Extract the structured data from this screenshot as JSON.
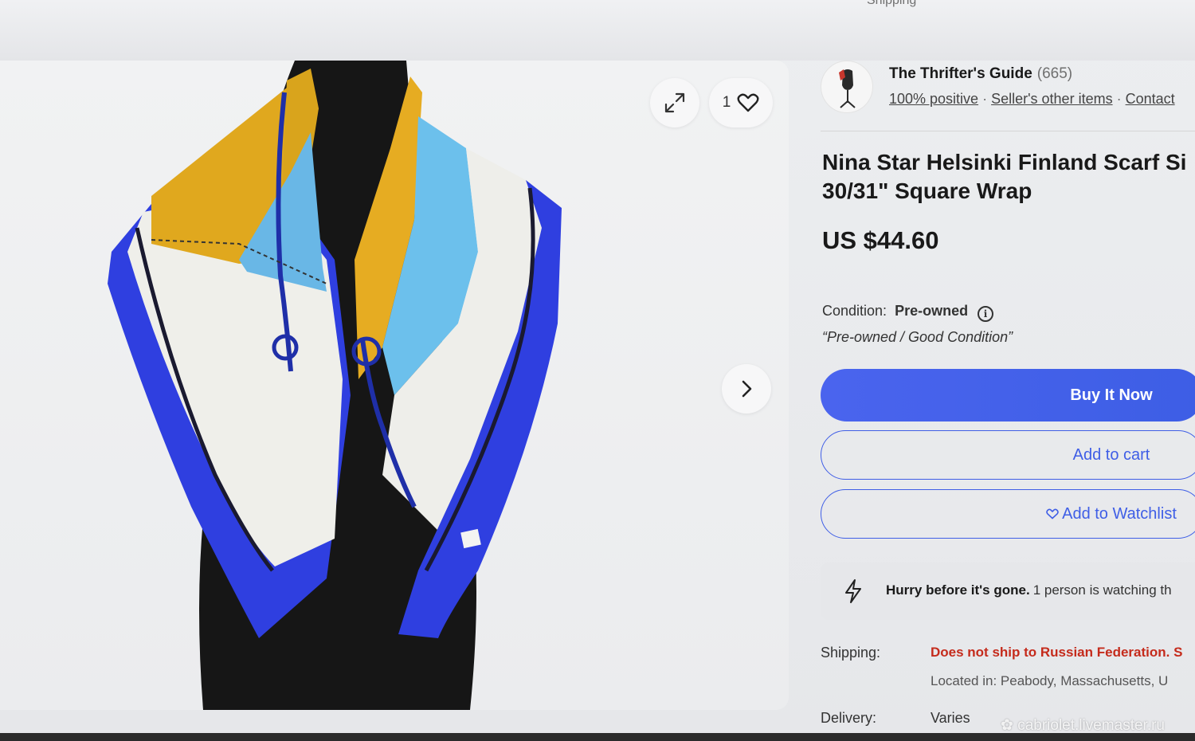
{
  "header": {
    "shipping_fragment": "Shipping"
  },
  "gallery": {
    "watch_count": "1",
    "icons": {
      "expand": "expand-icon",
      "heart": "heart-icon",
      "next": "chevron-right-icon"
    },
    "colors": {
      "scarf_blue": "#2f45e0",
      "scarf_gold": "#e0a81e",
      "scarf_light_blue": "#69b7e6"
    }
  },
  "seller": {
    "name": "The Thrifter's Guide",
    "count": "(665)",
    "positive": "100% positive",
    "other_items": "Seller's other items",
    "contact": "Contact"
  },
  "listing": {
    "title_line1": "Nina Star Helsinki Finland Scarf Si",
    "title_line2": "30/31\" Square Wrap",
    "price": "US $44.60",
    "condition_label": "Condition:",
    "condition_value": "Pre-owned",
    "condition_desc": "“Pre-owned / Good Condition”"
  },
  "actions": {
    "buy_now": "Buy It Now",
    "add_to_cart": "Add to cart",
    "add_to_watchlist": "Add to Watchlist"
  },
  "urgency": {
    "strong": "Hurry before it's gone.",
    "rest": "1 person is watching th"
  },
  "shipping": {
    "label": "Shipping:",
    "warning": "Does not ship to Russian Federation. S",
    "located": "Located in: Peabody, Massachusetts, U"
  },
  "delivery": {
    "label": "Delivery:",
    "value": "Varies"
  },
  "watermark": "cabriolet.livemaster.ru",
  "colors": {
    "primary": "#3f5ee6",
    "warning": "#c52b1c"
  }
}
